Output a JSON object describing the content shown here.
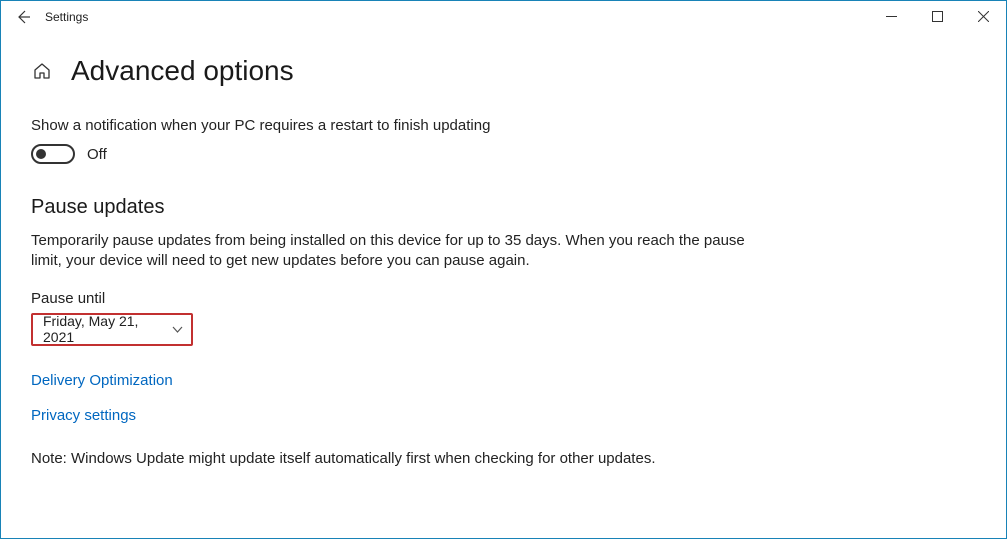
{
  "titlebar": {
    "app_name": "Settings"
  },
  "page": {
    "title": "Advanced options"
  },
  "notification_setting": {
    "label": "Show a notification when your PC requires a restart to finish updating",
    "toggle_state": "Off"
  },
  "pause_section": {
    "heading": "Pause updates",
    "description": "Temporarily pause updates from being installed on this device for up to 35 days. When you reach the pause limit, your device will need to get new updates before you can pause again.",
    "field_label": "Pause until",
    "selected_value": "Friday, May 21, 2021"
  },
  "links": {
    "delivery_optimization": "Delivery Optimization",
    "privacy_settings": "Privacy settings"
  },
  "note": "Note: Windows Update might update itself automatically first when checking for other updates."
}
